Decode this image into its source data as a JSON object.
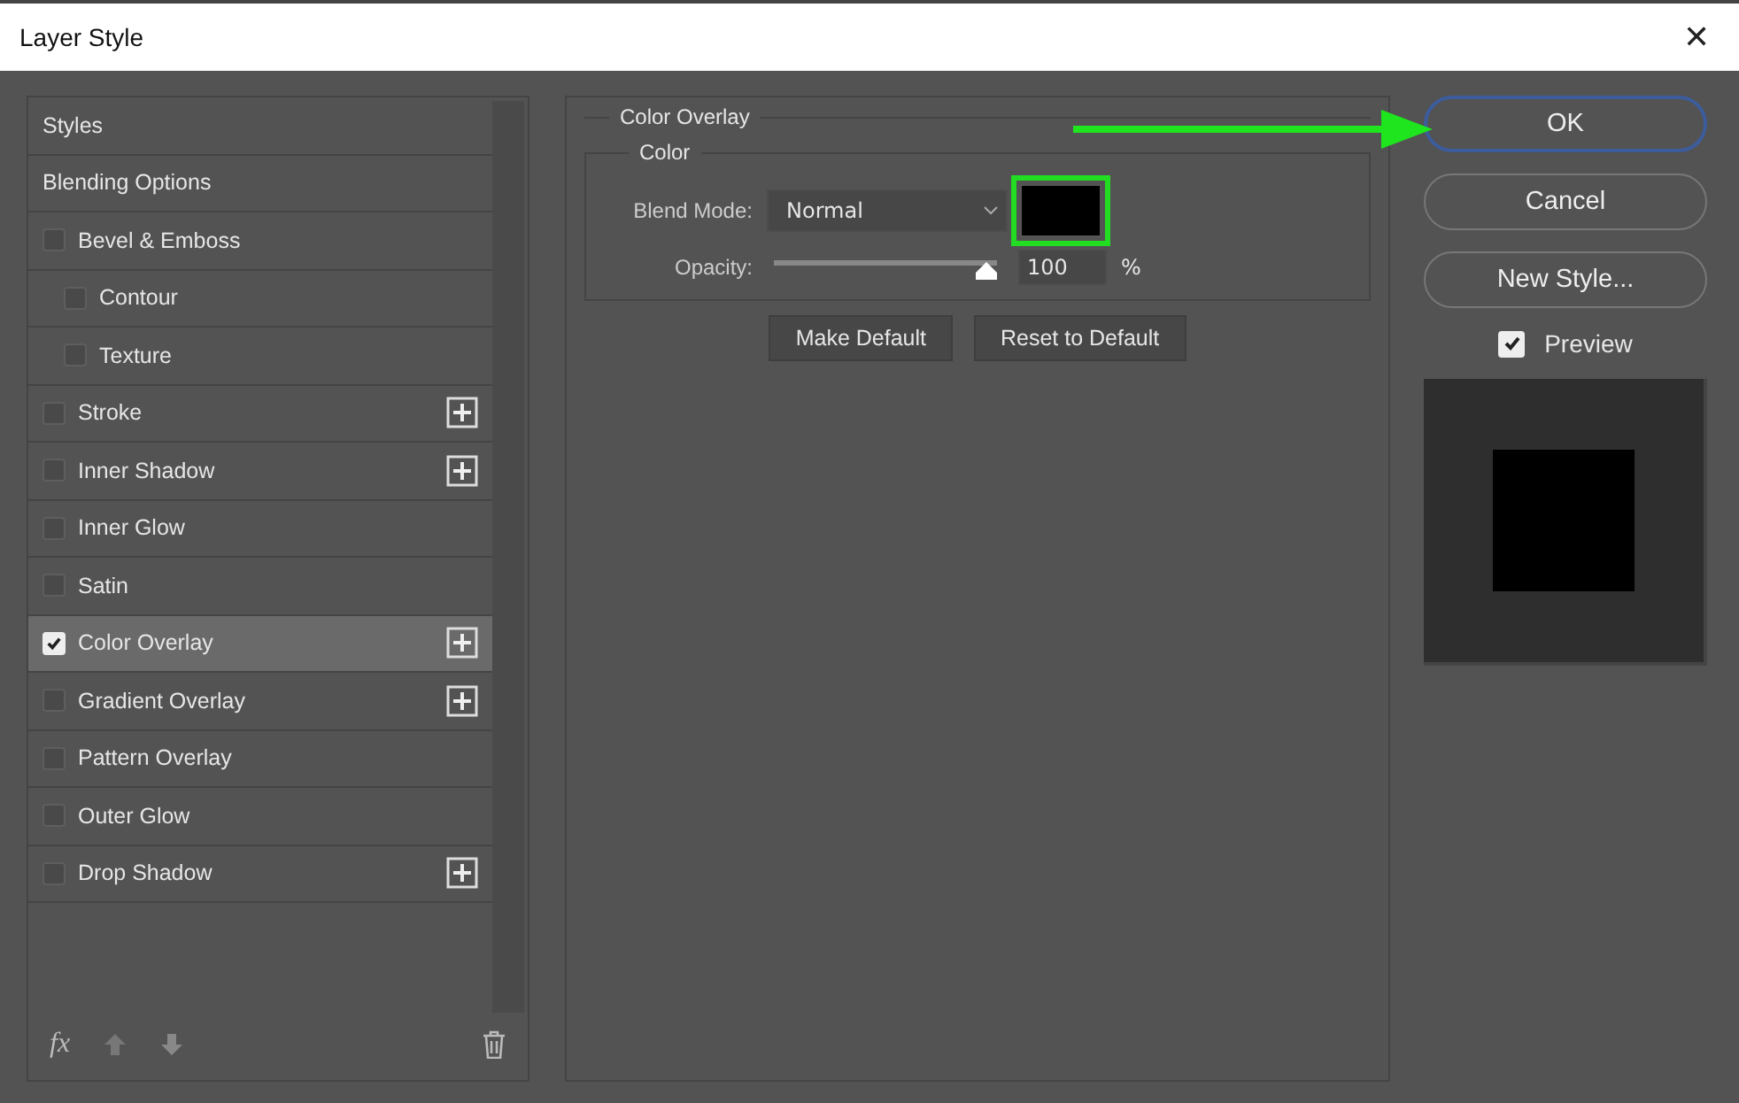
{
  "window": {
    "title": "Layer Style",
    "close": "✕"
  },
  "sidebar": {
    "items": [
      {
        "kind": "header",
        "label": "Styles",
        "selected": false
      },
      {
        "kind": "header",
        "label": "Blending Options",
        "selected": false
      },
      {
        "kind": "effect",
        "label": "Bevel & Emboss",
        "checked": false,
        "selected": false,
        "addable": false,
        "children": [
          {
            "kind": "effect",
            "label": "Contour",
            "checked": false,
            "selected": false,
            "addable": false
          },
          {
            "kind": "effect",
            "label": "Texture",
            "checked": false,
            "selected": false,
            "addable": false
          }
        ]
      },
      {
        "kind": "effect",
        "label": "Stroke",
        "checked": false,
        "selected": false,
        "addable": true
      },
      {
        "kind": "effect",
        "label": "Inner Shadow",
        "checked": false,
        "selected": false,
        "addable": true
      },
      {
        "kind": "effect",
        "label": "Inner Glow",
        "checked": false,
        "selected": false,
        "addable": false
      },
      {
        "kind": "effect",
        "label": "Satin",
        "checked": false,
        "selected": false,
        "addable": false
      },
      {
        "kind": "effect",
        "label": "Color Overlay",
        "checked": true,
        "selected": true,
        "addable": true
      },
      {
        "kind": "effect",
        "label": "Gradient Overlay",
        "checked": false,
        "selected": false,
        "addable": true
      },
      {
        "kind": "effect",
        "label": "Pattern Overlay",
        "checked": false,
        "selected": false,
        "addable": false
      },
      {
        "kind": "effect",
        "label": "Outer Glow",
        "checked": false,
        "selected": false,
        "addable": false
      },
      {
        "kind": "effect",
        "label": "Drop Shadow",
        "checked": false,
        "selected": false,
        "addable": true
      }
    ],
    "fx": "fx"
  },
  "panel": {
    "title": "Color Overlay",
    "group": "Color",
    "blend_label": "Blend Mode:",
    "blend_value": "Normal",
    "opacity_label": "Opacity:",
    "opacity": {
      "level": 1.0
    },
    "opacity_value": "100",
    "opacity_unit": "%",
    "buttons": [
      "Make Default",
      "Reset to Default"
    ]
  },
  "actions": {
    "buttons": [
      {
        "label": "OK",
        "selected": true
      },
      {
        "label": "Cancel",
        "selected": false
      },
      {
        "label": "New Style...",
        "selected": false
      }
    ],
    "preview": {
      "label": "Preview",
      "checked": true
    }
  }
}
